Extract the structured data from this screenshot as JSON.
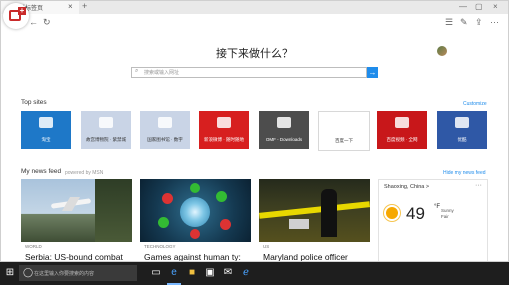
{
  "tab": {
    "title": "新标签页",
    "close": "×",
    "new": "+"
  },
  "window": {
    "minimize": "—",
    "restore": "▢",
    "close": "×"
  },
  "toolbar": {
    "back": "←",
    "refresh": "↻",
    "hub": "☰",
    "note": "✎",
    "share": "⇪",
    "more": "···"
  },
  "main": {
    "headline": "接下来做什么？",
    "search_placeholder": "搜索或输入网址",
    "search_go": "→"
  },
  "top_sites": {
    "label": "Top sites",
    "customize": "Customize",
    "tiles": [
      {
        "label": "淘宝",
        "color": "#1e78c8"
      },
      {
        "label": "故宫博物院 · 紫禁城",
        "color": "#c9d4e6"
      },
      {
        "label": "国家图书馆 · 数字",
        "color": "#c9d4e6"
      },
      {
        "label": "新浪微博 · 随时随地",
        "color": "#d71f1f"
      },
      {
        "label": "OMF - Downloads",
        "color": "#4d4d4d"
      },
      {
        "label": "百度一下",
        "color": "#ffffff"
      },
      {
        "label": "百度视频 · 全网",
        "color": "#c8171a"
      },
      {
        "label": "优酷",
        "color": "#2f58a6"
      }
    ]
  },
  "news": {
    "label": "My news feed",
    "powered": "powered by MSN",
    "hide": "Hide my news feed",
    "cards": [
      {
        "source": "WORLD",
        "title": "Serbia: US-bound combat"
      },
      {
        "source": "TECHNOLOGY",
        "title": "Games against human ty:"
      },
      {
        "source": "US",
        "title": "Maryland police officer"
      }
    ]
  },
  "weather": {
    "location": "Shaoxing, China >",
    "more": "···",
    "temp": "49",
    "unit": "°F",
    "desc1": "Sunny",
    "desc2": "Fair"
  },
  "taskbar": {
    "start": "⊞",
    "search_icon": "◯",
    "search_text": "在这里输入你要搜索的内容"
  }
}
